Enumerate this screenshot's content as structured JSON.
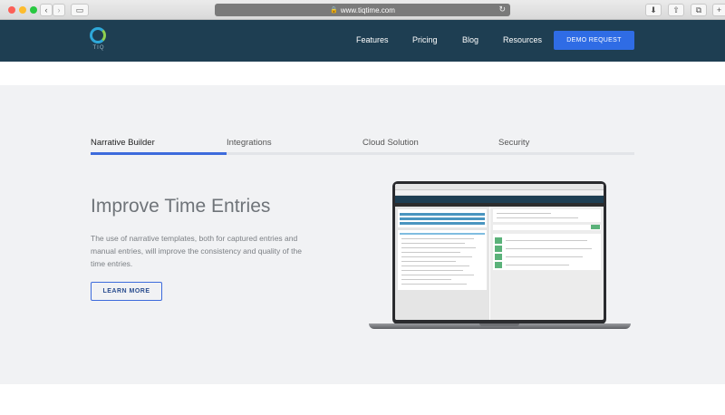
{
  "browser": {
    "url": "www.tiqtime.com",
    "lock_icon": "lock-icon"
  },
  "header": {
    "logo_text": "TIQ",
    "nav": [
      "Features",
      "Pricing",
      "Blog",
      "Resources"
    ],
    "cta": "DEMO REQUEST"
  },
  "tabs": [
    {
      "label": "Narrative Builder",
      "active": true
    },
    {
      "label": "Integrations",
      "active": false
    },
    {
      "label": "Cloud Solution",
      "active": false
    },
    {
      "label": "Security",
      "active": false
    }
  ],
  "feature": {
    "title": "Improve Time Entries",
    "body": "The use of narrative templates, both for captured entries and manual entries, will improve the consistency and quality of the time entries.",
    "button": "LEARN MORE"
  },
  "colors": {
    "header_bg": "#1e3e52",
    "accent": "#3d6bdc",
    "cta": "#2f6ce5",
    "section_bg": "#f1f2f4"
  }
}
